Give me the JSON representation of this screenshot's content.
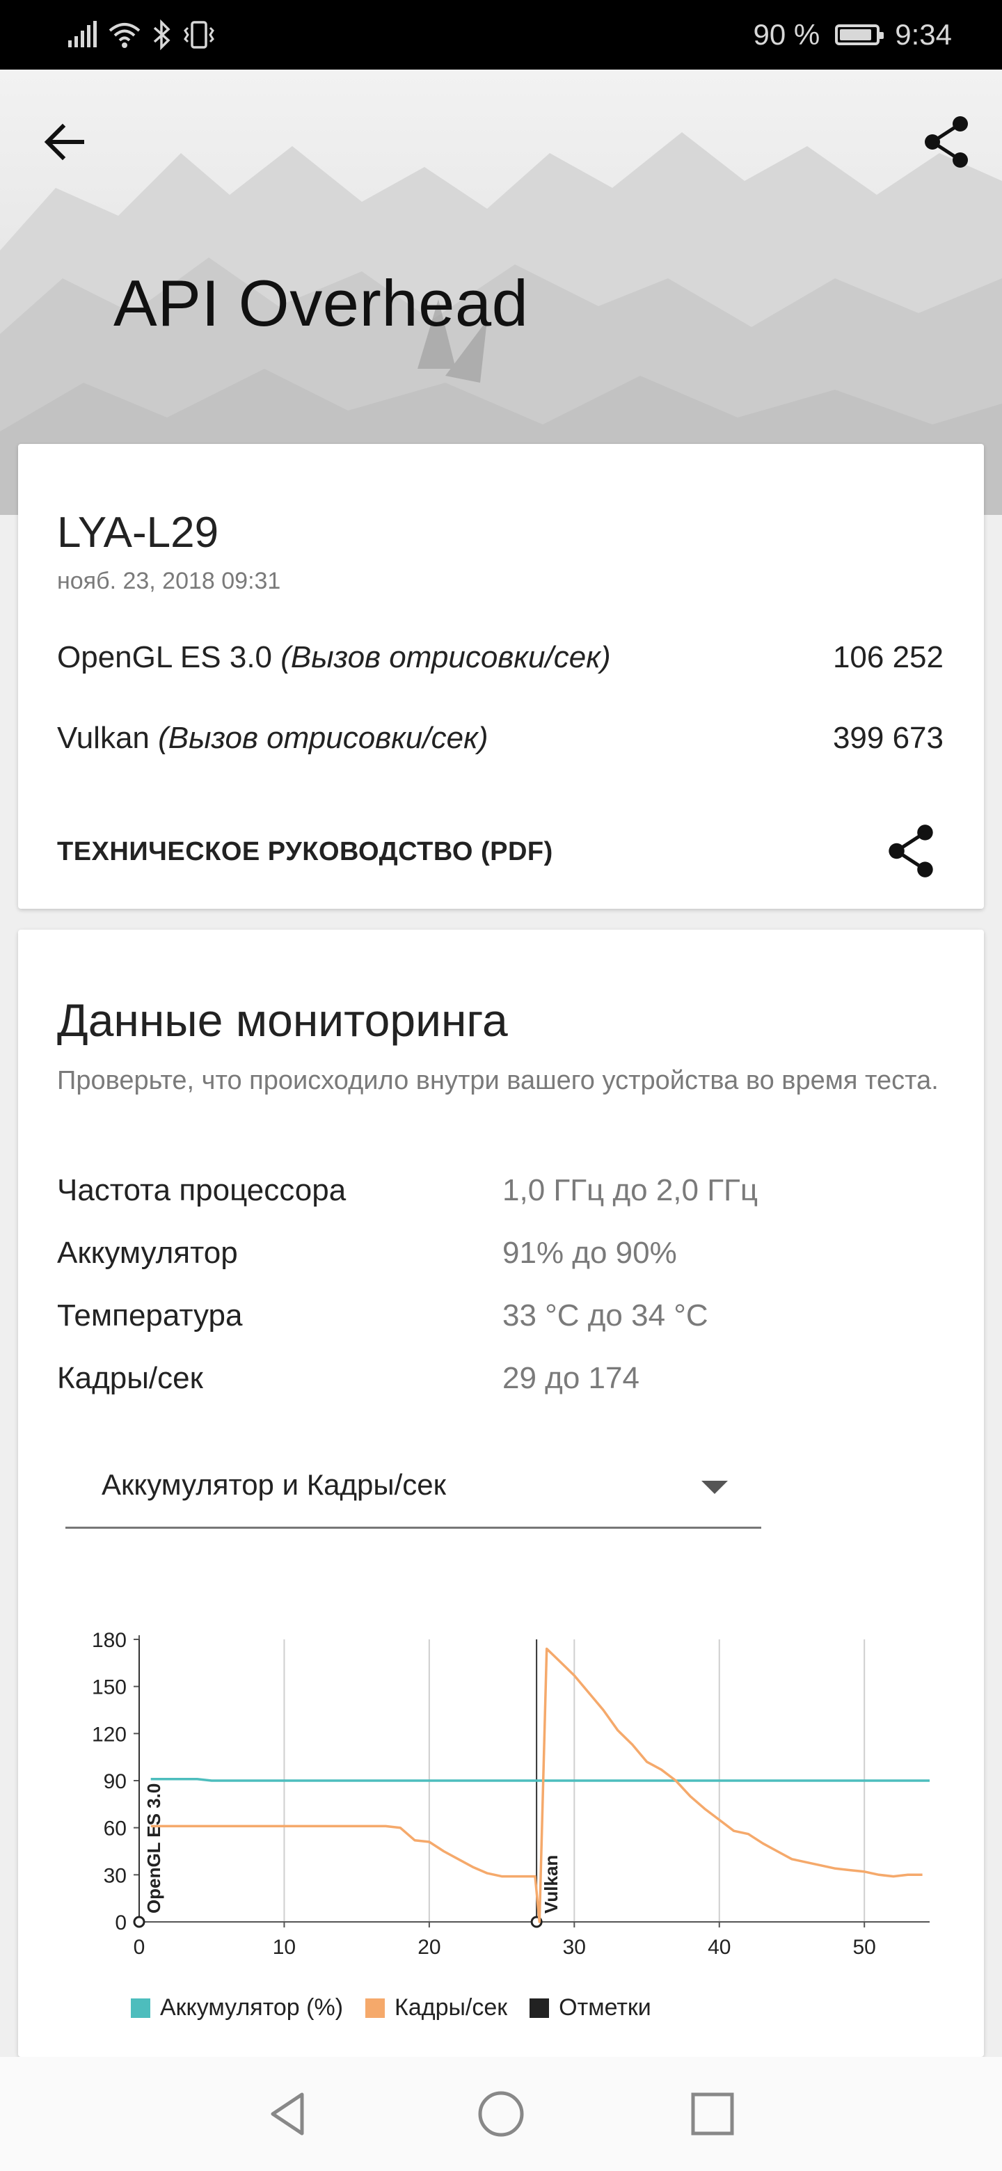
{
  "status_bar": {
    "battery_text": "90 %",
    "battery_level": 0.9,
    "time": "9:34",
    "icons": [
      "signal-icon",
      "wifi-icon",
      "bluetooth-icon",
      "vibrate-icon"
    ]
  },
  "header": {
    "title": "API Overhead",
    "back_icon": "arrow-back-icon",
    "share_icon": "share-icon"
  },
  "result": {
    "device": "LYA-L29",
    "date": "нояб. 23, 2018 09:31",
    "scores": [
      {
        "name": "OpenGL ES 3.0",
        "unit": "(Вызов отрисовки/сек)",
        "value": "106 252"
      },
      {
        "name": "Vulkan",
        "unit": "(Вызов отрисовки/сек)",
        "value": "399 673"
      }
    ],
    "tech_guide": "ТЕХНИЧЕСКОЕ РУКОВОДСТВО (PDF)"
  },
  "monitoring": {
    "title": "Данные мониторинга",
    "description": "Проверьте, что происходило внутри вашего устройства во время теста.",
    "stats": [
      {
        "label": "Частота процессора",
        "value": "1,0 ГГц до 2,0 ГГц"
      },
      {
        "label": "Аккумулятор",
        "value": "91% до 90%"
      },
      {
        "label": "Температура",
        "value": "33 °C до 34 °C"
      },
      {
        "label": "Кадры/сек",
        "value": "29 до 174"
      }
    ],
    "dropdown_selected": "Аккумулятор и Кадры/сек"
  },
  "chart_data": {
    "type": "line",
    "xlim": [
      0,
      54.5
    ],
    "ylim": [
      0,
      180
    ],
    "x_ticks": [
      0,
      10,
      20,
      30,
      40,
      50
    ],
    "y_ticks": [
      0,
      30,
      60,
      90,
      120,
      150,
      180
    ],
    "grid": "vertical",
    "legend_position": "bottom",
    "series": [
      {
        "name": "Аккумулятор (%)",
        "color": "#4dbdbd",
        "points": [
          [
            0.8,
            91
          ],
          [
            4,
            91
          ],
          [
            5,
            90
          ],
          [
            54.5,
            90
          ]
        ]
      },
      {
        "name": "Кадры/сек",
        "color": "#f5a96b",
        "points": [
          [
            0.8,
            61
          ],
          [
            3,
            61
          ],
          [
            6,
            61
          ],
          [
            9,
            61
          ],
          [
            12,
            61
          ],
          [
            15,
            61
          ],
          [
            17,
            61
          ],
          [
            18,
            60
          ],
          [
            19,
            52
          ],
          [
            20,
            51
          ],
          [
            21,
            45
          ],
          [
            22,
            40
          ],
          [
            23,
            35
          ],
          [
            24,
            31
          ],
          [
            25,
            29
          ],
          [
            26,
            29
          ],
          [
            27.3,
            29
          ],
          [
            27.6,
            0
          ],
          [
            28.1,
            174
          ],
          [
            29,
            166
          ],
          [
            30,
            157
          ],
          [
            31,
            146
          ],
          [
            32,
            135
          ],
          [
            33,
            122
          ],
          [
            34,
            113
          ],
          [
            35,
            102
          ],
          [
            36,
            97
          ],
          [
            37,
            90
          ],
          [
            38,
            80
          ],
          [
            39,
            72
          ],
          [
            40,
            65
          ],
          [
            41,
            58
          ],
          [
            42,
            56
          ],
          [
            43,
            50
          ],
          [
            44,
            45
          ],
          [
            45,
            40
          ],
          [
            46,
            38
          ],
          [
            47,
            36
          ],
          [
            48,
            34
          ],
          [
            49,
            33
          ],
          [
            50,
            32
          ],
          [
            51,
            30
          ],
          [
            52,
            29
          ],
          [
            53,
            30
          ],
          [
            54,
            30
          ]
        ]
      }
    ],
    "markers": [
      {
        "x": 0,
        "label": "OpenGL ES 3.0"
      },
      {
        "x": 27.4,
        "label": "Vulkan"
      }
    ],
    "legend": [
      {
        "label": "Аккумулятор (%)",
        "color": "#4dbdbd"
      },
      {
        "label": "Кадры/сек",
        "color": "#f5a96b"
      },
      {
        "label": "Отметки",
        "color": "#222222"
      }
    ]
  },
  "nav_bar": {
    "icons": [
      "nav-back-icon",
      "nav-home-icon",
      "nav-recents-icon"
    ]
  }
}
